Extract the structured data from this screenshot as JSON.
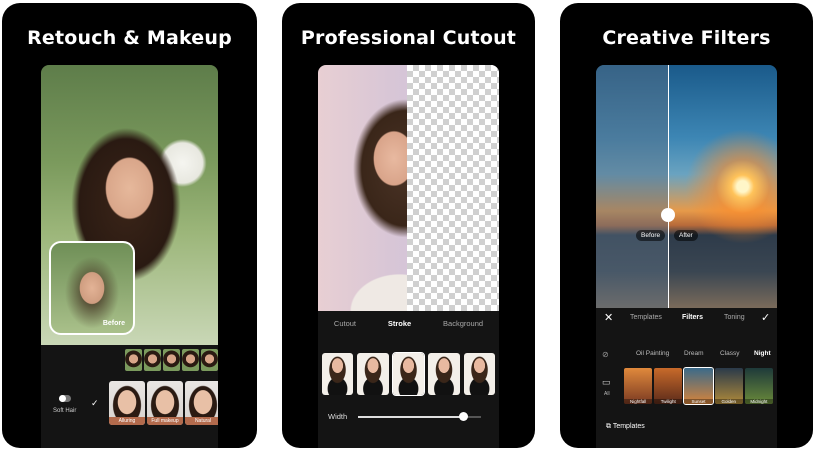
{
  "cards": [
    {
      "title": "Retouch & Makeup",
      "inset_label": "Before",
      "toggle_label": "Soft Hair",
      "check_icon": "check-icon",
      "faces": [
        "Alluring",
        "Full makeup",
        "Natural"
      ]
    },
    {
      "title": "Professional Cutout",
      "tabs": [
        "Cutout",
        "Stroke",
        "Background"
      ],
      "active_tab": "Stroke",
      "slider_label": "Width",
      "slider_value": 0.85
    },
    {
      "title": "Creative Filters",
      "before_label": "Before",
      "after_label": "After",
      "toolbar": {
        "close_icon": "close-icon",
        "tabs": [
          "Templates",
          "Filters",
          "Toning"
        ],
        "active_tab": "Filters",
        "confirm_icon": "check-icon"
      },
      "filter_categories": [
        "Oil Painting",
        "Dream",
        "Classy",
        "Night"
      ],
      "active_category": "Night",
      "all_label": "All",
      "filter_tiles": [
        "Nightfall",
        "Twilight",
        "Sunset",
        "Golden",
        "Midnight"
      ],
      "selected_tile": "Sunset",
      "templates_label": "Templates"
    }
  ],
  "colors": {
    "card_bg": "#000000",
    "page_bg": "#ffffff",
    "accent_face_label": "#b36b4d"
  }
}
